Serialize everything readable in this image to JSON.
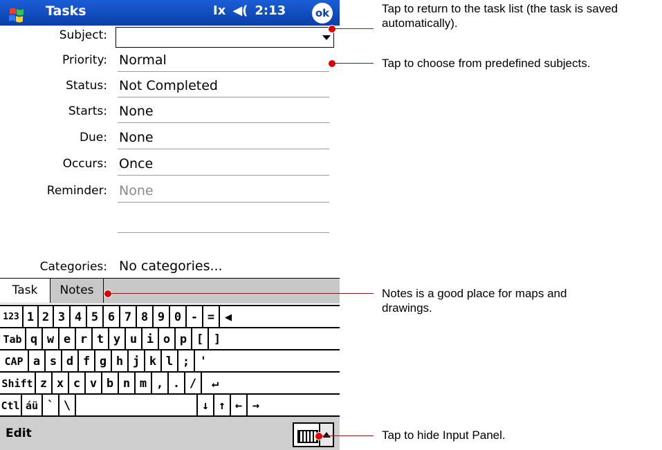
{
  "titlebar": {
    "app_title": "Tasks",
    "status": [
      "Ix",
      "◀(",
      "2:13"
    ],
    "ok_label": "ok"
  },
  "form": {
    "subject": {
      "label": "Subject:",
      "value": ""
    },
    "priority": {
      "label": "Priority:",
      "value": "Normal"
    },
    "status": {
      "label": "Status:",
      "value": "Not Completed"
    },
    "starts": {
      "label": "Starts:",
      "value": "None"
    },
    "due": {
      "label": "Due:",
      "value": "None"
    },
    "occurs": {
      "label": "Occurs:",
      "value": "Once"
    },
    "reminder": {
      "label": "Reminder:",
      "value": "None"
    },
    "categories": {
      "label": "Categories:",
      "value": "No categories..."
    }
  },
  "tabs": {
    "task": "Task",
    "notes": "Notes"
  },
  "keyboard": {
    "rows": [
      [
        "123",
        "1",
        "2",
        "3",
        "4",
        "5",
        "6",
        "7",
        "8",
        "9",
        "0",
        "-",
        "=",
        "◀"
      ],
      [
        "Tab",
        "q",
        "w",
        "e",
        "r",
        "t",
        "y",
        "u",
        "i",
        "o",
        "p",
        "[",
        "]"
      ],
      [
        "CAP",
        "a",
        "s",
        "d",
        "f",
        "g",
        "h",
        "j",
        "k",
        "l",
        ";",
        "'"
      ],
      [
        "Shift",
        "z",
        "x",
        "c",
        "v",
        "b",
        "n",
        "m",
        ",",
        ".",
        "/",
        "↵"
      ],
      [
        "Ctl",
        "áü",
        "`",
        "\\",
        "",
        "↓",
        "↑",
        "←",
        "→"
      ]
    ]
  },
  "menubar": {
    "edit": "Edit"
  },
  "callouts": {
    "ok": "Tap to return to the task list (the task is saved automatically).",
    "subject": "Tap to choose from predefined subjects.",
    "notes": "Notes is a good place for maps and drawings.",
    "input_panel": "Tap to hide Input Panel."
  },
  "colors": {
    "titlebar": "#0a3fa8",
    "callout_dot": "#e00000",
    "menubar": "#cfcfcf"
  }
}
